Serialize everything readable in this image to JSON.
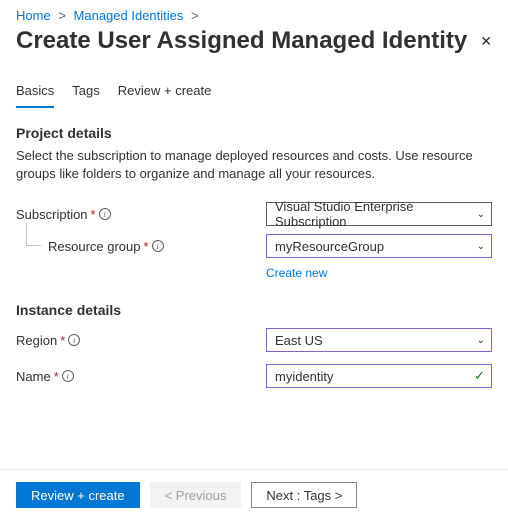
{
  "breadcrumb": {
    "home": "Home",
    "section": "Managed Identities"
  },
  "page_title": "Create User Assigned Managed Identity",
  "tabs": {
    "basics": "Basics",
    "tags": "Tags",
    "review": "Review + create"
  },
  "project_details": {
    "title": "Project details",
    "description": "Select the subscription to manage deployed resources and costs. Use resource groups like folders to organize and manage all your resources.",
    "subscription_label": "Subscription",
    "subscription_value": "Visual Studio Enterprise Subscription",
    "resource_group_label": "Resource group",
    "resource_group_value": "myResourceGroup",
    "create_new": "Create new"
  },
  "instance_details": {
    "title": "Instance details",
    "region_label": "Region",
    "region_value": "East US",
    "name_label": "Name",
    "name_value": "myidentity"
  },
  "footer": {
    "review": "Review + create",
    "previous": "< Previous",
    "next": "Next : Tags >"
  }
}
